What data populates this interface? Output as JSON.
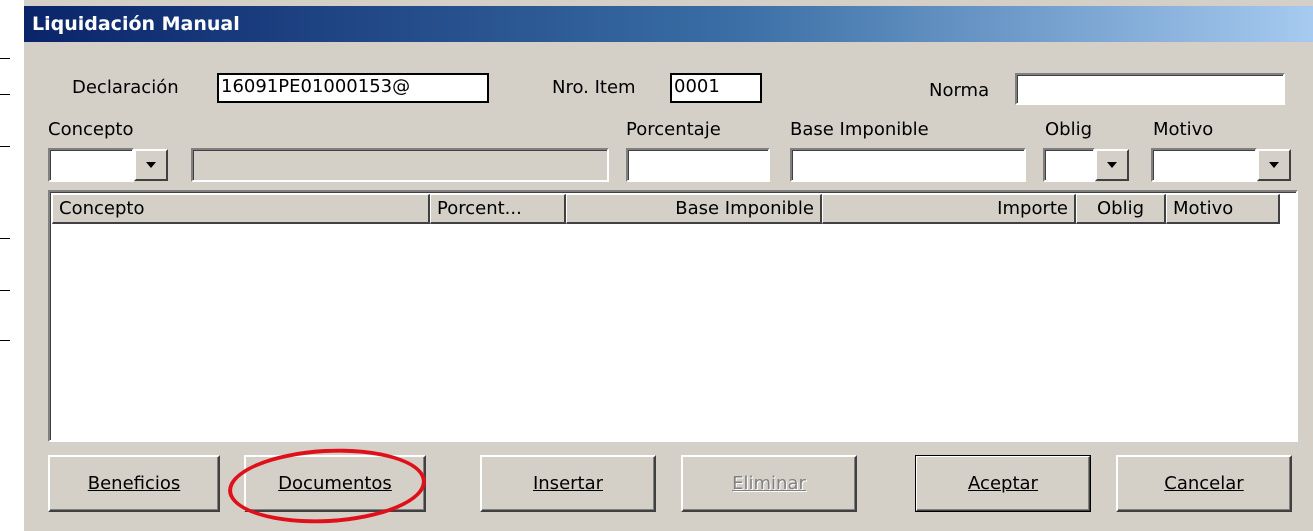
{
  "window": {
    "title": "Liquidación Manual"
  },
  "fields": {
    "declaracion": {
      "label": "Declaración",
      "value": "16091PE01000153@"
    },
    "nro_item": {
      "label": "Nro. Item",
      "value": "0001"
    },
    "norma": {
      "label": "Norma",
      "value": ""
    },
    "concepto": {
      "label": "Concepto",
      "code_value": "",
      "description_value": ""
    },
    "porcentaje": {
      "label": "Porcentaje",
      "value": ""
    },
    "base_imponible": {
      "label": "Base Imponible",
      "value": ""
    },
    "oblig": {
      "label": "Oblig",
      "value": ""
    },
    "motivo": {
      "label": "Motivo",
      "value": ""
    }
  },
  "grid": {
    "columns": [
      "Concepto",
      "Porcent...",
      "Base Imponible",
      "Importe",
      "Oblig",
      "Motivo"
    ],
    "rows": []
  },
  "buttons": {
    "beneficios": "Beneficios",
    "documentos": "Documentos",
    "insertar": "Insertar",
    "eliminar": "Eliminar",
    "aceptar": "Aceptar",
    "cancelar": "Cancelar"
  },
  "colors": {
    "annotation_circle": "#e0101a",
    "titlebar_start": "#0a246a",
    "titlebar_end": "#a6caf0"
  }
}
